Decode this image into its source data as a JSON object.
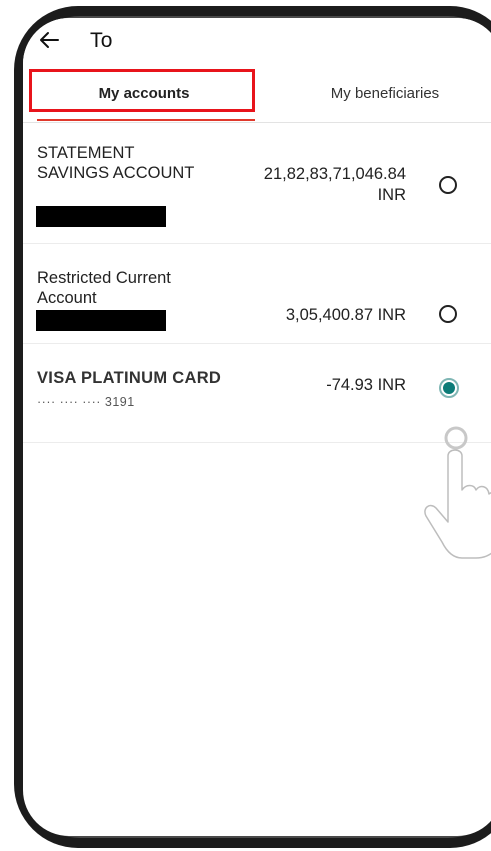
{
  "header": {
    "title": "To"
  },
  "tabs": [
    {
      "label": "My accounts",
      "selected": true
    },
    {
      "label": "My beneficiaries",
      "selected": false
    }
  ],
  "accounts": [
    {
      "name": "STATEMENT SAVINGS ACCOUNT",
      "balance_amount": "21,82,83,71,046.84",
      "balance_currency": "INR",
      "selected": false
    },
    {
      "name": "Restricted Current Account",
      "balance": "3,05,400.87 INR",
      "selected": false
    },
    {
      "name": "VISA PLATINUM CARD",
      "masked_number": "···· ···· ···· 3191",
      "balance": "-74.93 INR",
      "selected": true
    }
  ],
  "colors": {
    "tab_underline": "#e0392b",
    "highlight_box": "#e8141b",
    "radio_selected": "#0d7c78"
  },
  "icons": {
    "back": "arrow-left",
    "gesture": "tapping-hand"
  }
}
